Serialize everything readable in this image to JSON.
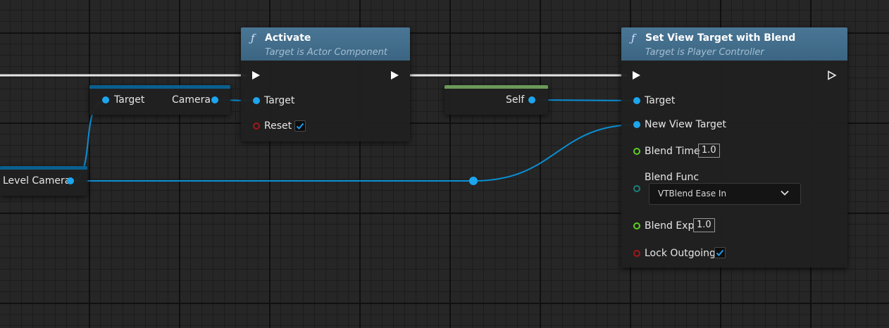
{
  "graph": {
    "nodes": {
      "get_level_camera": {
        "output_label": "Level Camera"
      },
      "get_camera": {
        "input_label": "Target",
        "output_label": "Camera"
      },
      "activate": {
        "title": "Activate",
        "subtitle": "Target is Actor Component",
        "icon": "function-icon",
        "pins": {
          "target": "Target",
          "reset": "Reset"
        },
        "reset_checked": true
      },
      "self": {
        "output_label": "Self"
      },
      "set_view_target": {
        "title": "Set View Target with Blend",
        "subtitle": "Target is Player Controller",
        "icon": "function-icon",
        "pins": {
          "target": "Target",
          "new_view_target": "New View Target",
          "blend_time": "Blend Time",
          "blend_func": "Blend Func",
          "blend_exp": "Blend Exp",
          "lock_outgoing": "Lock Outgoing"
        },
        "blend_time_value": "1.0",
        "blend_func_value": "VTBlend Ease In",
        "blend_exp_value": "1.0",
        "lock_outgoing_checked": true
      }
    },
    "colors": {
      "function_header": "#3f6783",
      "object_pin": "#1da5ee",
      "bool_pin": "#a1181a",
      "float_pin": "#5ccf22",
      "enum_pin": "#1e7f7a",
      "self_strip": "#6a9a58",
      "variable_strip": "#0a5f8f"
    }
  }
}
